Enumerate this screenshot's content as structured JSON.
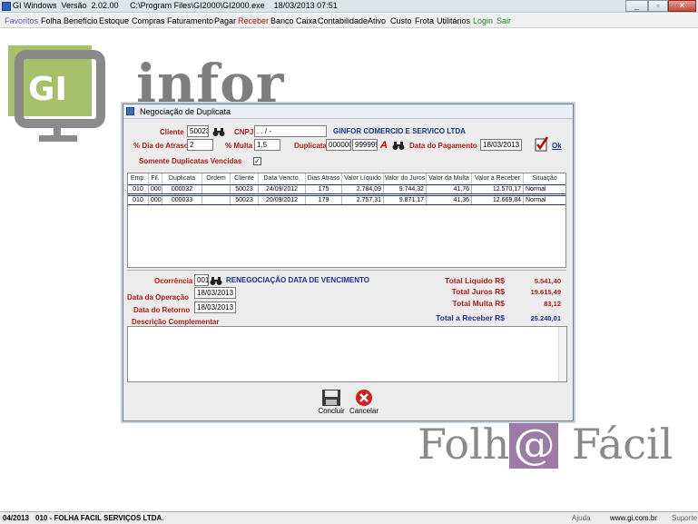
{
  "window": {
    "title": "GI Windows  Versão  2.02.00     C:\\Program Files\\GI2000\\GI2000.exe    18/03/2013 07:51",
    "min": "_",
    "max": "▫",
    "close": "✕"
  },
  "menu": [
    {
      "label": "Favoritos",
      "color": "#6a5acd"
    },
    {
      "label": "Folha",
      "color": "#000000"
    },
    {
      "label": "Benefício",
      "color": "#000000"
    },
    {
      "label": "Estoque",
      "color": "#000000"
    },
    {
      "label": "Compras",
      "color": "#000000"
    },
    {
      "label": "Faturamento",
      "color": "#000000"
    },
    {
      "label": "Pagar",
      "color": "#000000"
    },
    {
      "label": "Receber",
      "color": "#c00000"
    },
    {
      "label": "Banco",
      "color": "#000000"
    },
    {
      "label": "Caixa",
      "color": "#000000"
    },
    {
      "label": "Contabilidade",
      "color": "#000000"
    },
    {
      "label": "Ativo",
      "color": "#000000"
    },
    {
      "label": "Custo",
      "color": "#000000"
    },
    {
      "label": "Frota",
      "color": "#000000"
    },
    {
      "label": "Utilitários",
      "color": "#000000"
    },
    {
      "label": "Login",
      "color": "#1a8a1a"
    },
    {
      "label": "Sair",
      "color": "#1a8a1a"
    }
  ],
  "background": {
    "logo_text": "GI",
    "brand": "infor",
    "folha_left": "Folh",
    "folha_at": "@",
    "folha_right": " Fácil"
  },
  "dialog": {
    "title": "Negociação de Duplicata",
    "cliente_label": "Cliente",
    "cliente_value": "50023",
    "cnpj_label": "CNPJ",
    "cnpj_value": ". . /  -",
    "company_name": "GINFOR COMERCIO E SERVICO LTDA",
    "dia_atraso_label": "% Dia de Atraso",
    "dia_atraso_value": "2",
    "multa_label": "% Multa",
    "multa_value": "1,5",
    "duplicata_label": "Duplicata",
    "duplicata_from": "000000",
    "duplicata_to": "999999",
    "data_pagamento_label": "Data do Pagamento",
    "data_pagamento_value": "18/03/2013",
    "ok_label": "Ok",
    "vencidas_label": "Somente Duplicatas Vencidas",
    "vencidas_checked": "✓",
    "table": {
      "headers": [
        "Emp.",
        "Fil.",
        "Duplicata",
        "Ordem",
        "Cliente",
        "Data Vencto.",
        "Dias Atraso",
        "Valor Líquido",
        "Valor do Juros",
        "Valor da Multa",
        "Valor a Receber",
        "Situação"
      ],
      "rows": [
        [
          "010",
          "000",
          "000032",
          "",
          "50023",
          "24/09/2012",
          "175",
          "2.784,09",
          "9.744,32",
          "41,76",
          "12.570,17",
          "Normal"
        ],
        [
          "010",
          "000",
          "000033",
          "",
          "50023",
          "20/09/2012",
          "179",
          "2.757,31",
          "9.871,17",
          "41,36",
          "12.669,84",
          "Normal"
        ]
      ]
    },
    "ocorrencia_label": "Ocorrência",
    "ocorrencia_code": "001",
    "ocorrencia_desc": "RENEGOCIAÇÃO DATA DE VENCIMENTO",
    "data_operacao_label": "Data da Operação",
    "data_operacao_value": "18/03/2013",
    "data_retorno_label": "Data do Retorno",
    "data_retorno_value": "18/03/2013",
    "descricao_label": "Descrição Complementar",
    "totals": {
      "liquido_label": "Total Liquido R$",
      "liquido_value": "5.541,40",
      "juros_label": "Total Juros R$",
      "juros_value": "19.615,49",
      "multa_label": "Total Multa R$",
      "multa_value": "83,12",
      "receber_label": "Total a Receber R$",
      "receber_value": "25.240,01"
    },
    "concluir_label": "Concluir",
    "cancelar_label": "Cancelar"
  },
  "status": {
    "period": "04/2013",
    "company": "010 - FOLHA FACIL SERVIÇOS LTDA.",
    "ajuda": "Ajuda",
    "site": "www.gi.com.br",
    "suporte": "Suporte"
  }
}
